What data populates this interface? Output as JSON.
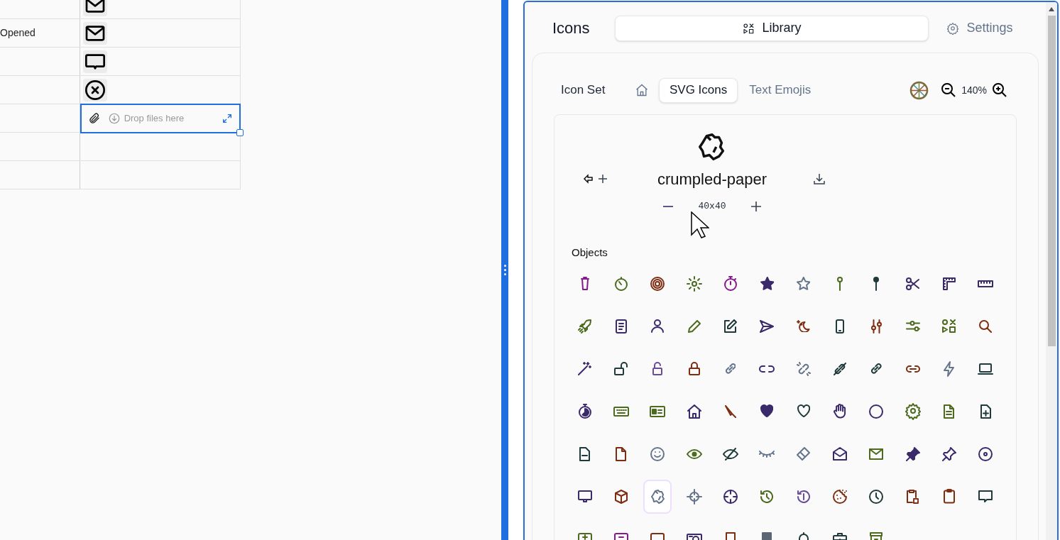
{
  "table": {
    "rows": [
      {
        "kind": "mail",
        "selected": false
      },
      {
        "status": "Opened",
        "kind": "mail",
        "selected": false
      },
      {
        "kind": "comment",
        "selected": false
      },
      {
        "kind": "cancel",
        "selected": false
      },
      {
        "kind": "dropzone",
        "placeholder": "Drop files here",
        "selected": true
      },
      {
        "kind": "empty",
        "selected": false
      },
      {
        "kind": "empty",
        "selected": false
      }
    ]
  },
  "panel": {
    "title": "Icons",
    "tabs": [
      {
        "label": "Library",
        "selected": true
      },
      {
        "label": "Settings",
        "selected": false
      }
    ],
    "subtabs": {
      "label": "Icon Set",
      "items": [
        {
          "label": "SVG Icons",
          "selected": true
        },
        {
          "label": "Text Emojis",
          "selected": false
        }
      ]
    },
    "zoom": "140%",
    "preview": {
      "name": "crumpled-paper",
      "size": "40x40"
    },
    "category": "Objects",
    "icons": [
      {
        "kind": "trash",
        "color": "#86198f",
        "selected": false
      },
      {
        "kind": "timer",
        "color": "#4d6b1e",
        "selected": false
      },
      {
        "kind": "target",
        "color": "#7c2d12",
        "selected": false
      },
      {
        "kind": "sun",
        "color": "#4d6b1e",
        "selected": false
      },
      {
        "kind": "stopwatch",
        "color": "#86198f",
        "selected": false
      },
      {
        "kind": "star-filled",
        "color": "#3b2a6b",
        "selected": false
      },
      {
        "kind": "star",
        "color": "#64748b",
        "selected": false
      },
      {
        "kind": "pin",
        "color": "#4d6b1e",
        "selected": false
      },
      {
        "kind": "pin-filled",
        "color": "#1e3a3a",
        "selected": false
      },
      {
        "kind": "scissors",
        "color": "#3b2a6b",
        "selected": false
      },
      {
        "kind": "ruler-corner",
        "color": "#3b2a6b",
        "selected": false
      },
      {
        "kind": "ruler",
        "color": "#3b2a6b",
        "selected": false
      },
      {
        "kind": "rocket",
        "color": "#4d6b1e",
        "selected": false
      },
      {
        "kind": "document",
        "color": "#3b2a6b",
        "selected": false
      },
      {
        "kind": "user",
        "color": "#3b2a6b",
        "selected": false
      },
      {
        "kind": "pencil",
        "color": "#4d6b1e",
        "selected": false
      },
      {
        "kind": "edit",
        "color": "#1e3a3a",
        "selected": false
      },
      {
        "kind": "send",
        "color": "#3b2a6b",
        "selected": false
      },
      {
        "kind": "moon",
        "color": "#7c2d12",
        "selected": false
      },
      {
        "kind": "phone",
        "color": "#1e3a3a",
        "selected": false
      },
      {
        "kind": "sliders-vertical",
        "color": "#7c2d12",
        "selected": false
      },
      {
        "kind": "sliders",
        "color": "#4d6b1e",
        "selected": false
      },
      {
        "kind": "shapes",
        "color": "#4d6b1e",
        "selected": false
      },
      {
        "kind": "search",
        "color": "#7c2d12",
        "selected": false
      },
      {
        "kind": "wand",
        "color": "#3b2a6b",
        "selected": false
      },
      {
        "kind": "unlock",
        "color": "#1e3a3a",
        "selected": false
      },
      {
        "kind": "lock-open",
        "color": "#6b4c9a",
        "selected": false
      },
      {
        "kind": "lock",
        "color": "#7c2d12",
        "selected": false
      },
      {
        "kind": "link",
        "color": "#64748b",
        "selected": false
      },
      {
        "kind": "unlinked",
        "color": "#3b2a6b",
        "selected": false
      },
      {
        "kind": "link-broken",
        "color": "#64748b",
        "selected": false
      },
      {
        "kind": "link-off",
        "color": "#1e3a3a",
        "selected": false
      },
      {
        "kind": "link",
        "color": "#1e3a3a",
        "selected": false
      },
      {
        "kind": "link-horizontal",
        "color": "#7c2d12",
        "selected": false
      },
      {
        "kind": "bolt",
        "color": "#64748b",
        "selected": false
      },
      {
        "kind": "laptop",
        "color": "#1e3a3a",
        "selected": false
      },
      {
        "kind": "stopwatch-filled",
        "color": "#3b2a6b",
        "selected": false
      },
      {
        "kind": "keyboard",
        "color": "#4d6b1e",
        "selected": false
      },
      {
        "kind": "id-card",
        "color": "#4d6b1e",
        "selected": false
      },
      {
        "kind": "house",
        "color": "#3b2a6b",
        "selected": false
      },
      {
        "kind": "knife",
        "color": "#7c2d12",
        "selected": false
      },
      {
        "kind": "heart-filled",
        "color": "#3b2a6b",
        "selected": false
      },
      {
        "kind": "heart",
        "color": "#1e3a3a",
        "selected": false
      },
      {
        "kind": "hand",
        "color": "#3b2a6b",
        "selected": false
      },
      {
        "kind": "circle",
        "color": "#3b2a6b",
        "selected": false
      },
      {
        "kind": "gear",
        "color": "#4d6b1e",
        "selected": false
      },
      {
        "kind": "file-text",
        "color": "#4d6b1e",
        "selected": false
      },
      {
        "kind": "file-plus",
        "color": "#1e3a3a",
        "selected": false
      },
      {
        "kind": "file-minus",
        "color": "#1e3a3a",
        "selected": false
      },
      {
        "kind": "file",
        "color": "#7c2d12",
        "selected": false
      },
      {
        "kind": "smile",
        "color": "#64748b",
        "selected": false
      },
      {
        "kind": "eye",
        "color": "#4d6b1e",
        "selected": false
      },
      {
        "kind": "eye-off",
        "color": "#1e3a3a",
        "selected": false
      },
      {
        "kind": "eye-closed",
        "color": "#64748b",
        "selected": false
      },
      {
        "kind": "eraser",
        "color": "#64748b",
        "selected": false
      },
      {
        "kind": "mail-open",
        "color": "#3b2a6b",
        "selected": false
      },
      {
        "kind": "envelope",
        "color": "#4d6b1e",
        "selected": false
      },
      {
        "kind": "pushpin-filled",
        "color": "#3b2a6b",
        "selected": false
      },
      {
        "kind": "pushpin",
        "color": "#3b2a6b",
        "selected": false
      },
      {
        "kind": "disc",
        "color": "#3b2a6b",
        "selected": false
      },
      {
        "kind": "monitor",
        "color": "#3b2a6b",
        "selected": false
      },
      {
        "kind": "cube",
        "color": "#7c2d12",
        "selected": false
      },
      {
        "kind": "crumpled-paper",
        "color": "#64748b",
        "selected": true
      },
      {
        "kind": "crosshair",
        "color": "#64748b",
        "selected": false
      },
      {
        "kind": "crosshair-circle",
        "color": "#3b2a6b",
        "selected": false
      },
      {
        "kind": "history",
        "color": "#4d6b1e",
        "selected": false
      },
      {
        "kind": "history-alert",
        "color": "#6b4c9a",
        "selected": false
      },
      {
        "kind": "cookie",
        "color": "#7c2d12",
        "selected": false
      },
      {
        "kind": "clock",
        "color": "#1e3a3a",
        "selected": false
      },
      {
        "kind": "clipboard-dashed",
        "color": "#7c2d12",
        "selected": false
      },
      {
        "kind": "clipboard",
        "color": "#7c2d12",
        "selected": false
      },
      {
        "kind": "chat",
        "color": "#1e3a3a",
        "selected": false
      },
      {
        "kind": "tray-plus",
        "color": "#4d6b1e",
        "selected": false
      },
      {
        "kind": "tray-minus",
        "color": "#86198f",
        "selected": false
      },
      {
        "kind": "tray",
        "color": "#7c2d12",
        "selected": false
      },
      {
        "kind": "camera",
        "color": "#3b2a6b",
        "selected": false
      },
      {
        "kind": "bookmark",
        "color": "#7c2d12",
        "selected": false
      },
      {
        "kind": "bookmark-filled",
        "color": "#5b6675",
        "selected": false
      },
      {
        "kind": "bell",
        "color": "#1e3a3a",
        "selected": false
      },
      {
        "kind": "briefcase",
        "color": "#1e3a3a",
        "selected": false
      },
      {
        "kind": "archive",
        "color": "#4d6b1e",
        "selected": false
      }
    ]
  }
}
